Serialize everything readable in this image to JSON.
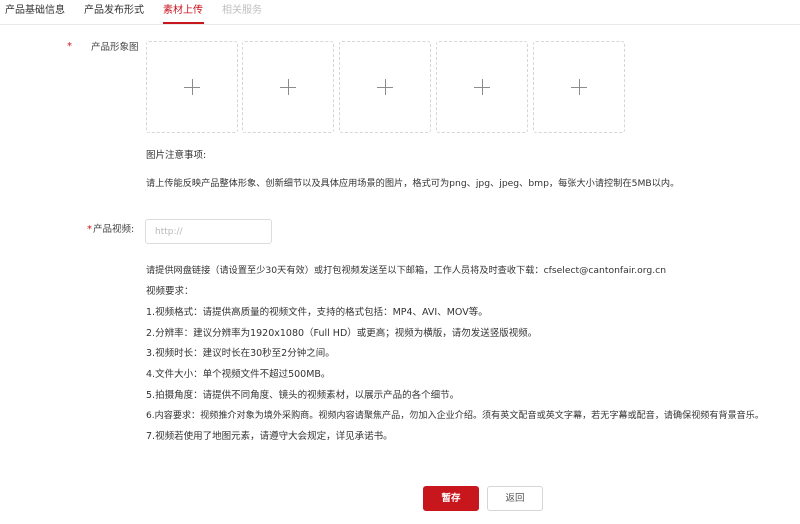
{
  "tabs": [
    {
      "label": "产品基础信息",
      "state": "normal"
    },
    {
      "label": "产品发布形式",
      "state": "normal"
    },
    {
      "label": "素材上传",
      "state": "active"
    },
    {
      "label": "相关服务",
      "state": "disabled"
    }
  ],
  "colors": {
    "accent": "#c8161d"
  },
  "image_section": {
    "required_mark": "*",
    "label": "产品形象图",
    "upload_slot_count": 5,
    "notes_title": "图片注意事项:",
    "notes_text": "请上传能反映产品整体形象、创新细节以及具体应用场景的图片，格式可为png、jpg、jpeg、bmp，每张大小请控制在5MB以内。"
  },
  "video_section": {
    "required_mark": "*",
    "label": "产品视频:",
    "input_placeholder": "http://",
    "input_value": "",
    "intro": "请提供网盘链接（请设置至少30天有效）或打包视频发送至以下邮箱，工作人员将及时查收下载：cfselect@cantonfair.org.cn",
    "requirements_title": "视频要求：",
    "requirements": [
      "1.视频格式：请提供高质量的视频文件，支持的格式包括：MP4、AVI、MOV等。",
      "2.分辨率：建议分辨率为1920x1080（Full HD）或更高；视频为横版，请勿发送竖版视频。",
      "3.视频时长：建议时长在30秒至2分钟之间。",
      "4.文件大小：单个视频文件不超过500MB。",
      "5.拍摄角度：请提供不同角度、镜头的视频素材，以展示产品的各个细节。",
      "6.内容要求：视频推介对象为境外采购商。视频内容请聚焦产品，勿加入企业介绍。须有英文配音或英文字幕，若无字幕或配音，请确保视频有背景音乐。",
      "7.视频若使用了地图元素，请遵守大会规定，详见承诺书。"
    ]
  },
  "actions": {
    "save_label": "暂存",
    "back_label": "返回"
  }
}
